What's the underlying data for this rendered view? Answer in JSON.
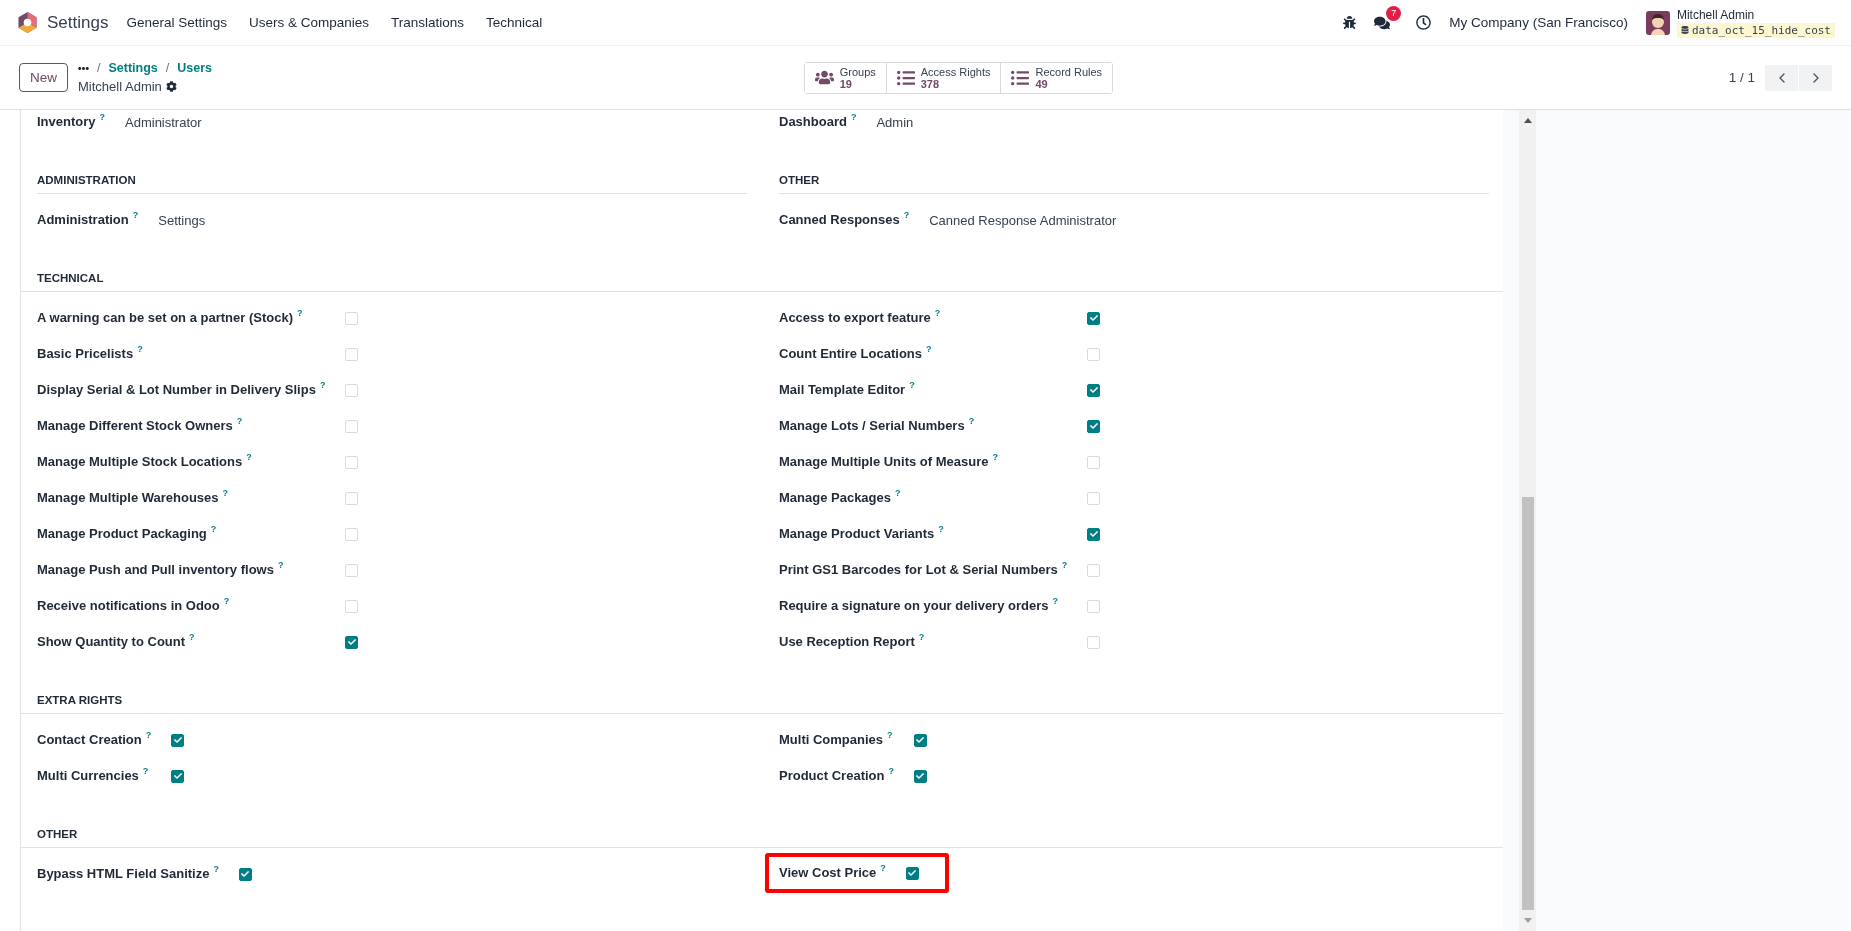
{
  "navbar": {
    "app": "Settings",
    "menu": [
      "General Settings",
      "Users & Companies",
      "Translations",
      "Technical"
    ],
    "messages_badge": "7",
    "company": "My Company (San Francisco)",
    "user": "Mitchell Admin",
    "database": "data_oct_15_hide_cost"
  },
  "control_panel": {
    "new_button": "New",
    "breadcrumb": {
      "separator": "/",
      "items": [
        "Settings",
        "Users"
      ]
    },
    "record_title": "Mitchell Admin",
    "smart_buttons": [
      {
        "kind": "groups",
        "label": "Groups",
        "count": "19"
      },
      {
        "kind": "list",
        "label": "Access Rights",
        "count": "378"
      },
      {
        "kind": "list",
        "label": "Record Rules",
        "count": "49"
      }
    ],
    "pager": "1 / 1"
  },
  "sections": [
    {
      "kind": "split",
      "groups": [
        {
          "items": [
            {
              "kind": "select",
              "label": "Inventory",
              "help": "?",
              "value": "Administrator"
            }
          ]
        },
        {
          "items": [
            {
              "kind": "select",
              "label": "Dashboard",
              "help": "?",
              "value": "Admin"
            }
          ]
        }
      ]
    },
    {
      "kind": "split",
      "groups": [
        {
          "title": "ADMINISTRATION",
          "items": [
            {
              "kind": "select",
              "label": "Administration",
              "help": "?",
              "value": "Settings"
            }
          ]
        },
        {
          "title": "OTHER",
          "items": [
            {
              "kind": "select",
              "label": "Canned Responses",
              "help": "?",
              "value": "Canned Response Administrator"
            }
          ]
        }
      ]
    },
    {
      "kind": "full",
      "title": "TECHNICAL",
      "columns": [
        [
          {
            "kind": "checkbox",
            "label": "A warning can be set on a partner (Stock)",
            "help": "?",
            "checked": false
          },
          {
            "kind": "checkbox",
            "label": "Basic Pricelists",
            "help": "?",
            "checked": false
          },
          {
            "kind": "checkbox",
            "label": "Display Serial & Lot Number in Delivery Slips",
            "help": "?",
            "checked": false
          },
          {
            "kind": "checkbox",
            "label": "Manage Different Stock Owners",
            "help": "?",
            "checked": false
          },
          {
            "kind": "checkbox",
            "label": "Manage Multiple Stock Locations",
            "help": "?",
            "checked": false
          },
          {
            "kind": "checkbox",
            "label": "Manage Multiple Warehouses",
            "help": "?",
            "checked": false
          },
          {
            "kind": "checkbox",
            "label": "Manage Product Packaging",
            "help": "?",
            "checked": false
          },
          {
            "kind": "checkbox",
            "label": "Manage Push and Pull inventory flows",
            "help": "?",
            "checked": false
          },
          {
            "kind": "checkbox",
            "label": "Receive notifications in Odoo",
            "help": "?",
            "checked": false
          },
          {
            "kind": "checkbox",
            "label": "Show Quantity to Count",
            "help": "?",
            "checked": true
          }
        ],
        [
          {
            "kind": "checkbox",
            "label": "Access to export feature",
            "help": "?",
            "checked": true
          },
          {
            "kind": "checkbox",
            "label": "Count Entire Locations",
            "help": "?",
            "checked": false
          },
          {
            "kind": "checkbox",
            "label": "Mail Template Editor",
            "help": "?",
            "checked": true
          },
          {
            "kind": "checkbox",
            "label": "Manage Lots / Serial Numbers",
            "help": "?",
            "checked": true
          },
          {
            "kind": "checkbox",
            "label": "Manage Multiple Units of Measure",
            "help": "?",
            "checked": false
          },
          {
            "kind": "checkbox",
            "label": "Manage Packages",
            "help": "?",
            "checked": false
          },
          {
            "kind": "checkbox",
            "label": "Manage Product Variants",
            "help": "?",
            "checked": true
          },
          {
            "kind": "checkbox",
            "label": "Print GS1 Barcodes for Lot & Serial Numbers",
            "help": "?",
            "checked": false
          },
          {
            "kind": "checkbox",
            "label": "Require a signature on your delivery orders",
            "help": "?",
            "checked": false
          },
          {
            "kind": "checkbox",
            "label": "Use Reception Report",
            "help": "?",
            "checked": false
          }
        ]
      ]
    },
    {
      "kind": "full",
      "title": "EXTRA RIGHTS",
      "columns": [
        [
          {
            "kind": "checkbox",
            "label": "Contact Creation",
            "help": "?",
            "checked": true
          },
          {
            "kind": "checkbox",
            "label": "Multi Currencies",
            "help": "?",
            "checked": true
          }
        ],
        [
          {
            "kind": "checkbox",
            "label": "Multi Companies",
            "help": "?",
            "checked": true
          },
          {
            "kind": "checkbox",
            "label": "Product Creation",
            "help": "?",
            "checked": true
          }
        ]
      ]
    },
    {
      "kind": "full",
      "title": "OTHER",
      "columns": [
        [
          {
            "kind": "checkbox",
            "label": "Bypass HTML Field Sanitize",
            "help": "?",
            "checked": true,
            "highlighted": false
          }
        ],
        [
          {
            "kind": "checkbox",
            "label": "View Cost Price",
            "help": "?",
            "checked": true,
            "highlighted": true
          }
        ]
      ]
    }
  ]
}
